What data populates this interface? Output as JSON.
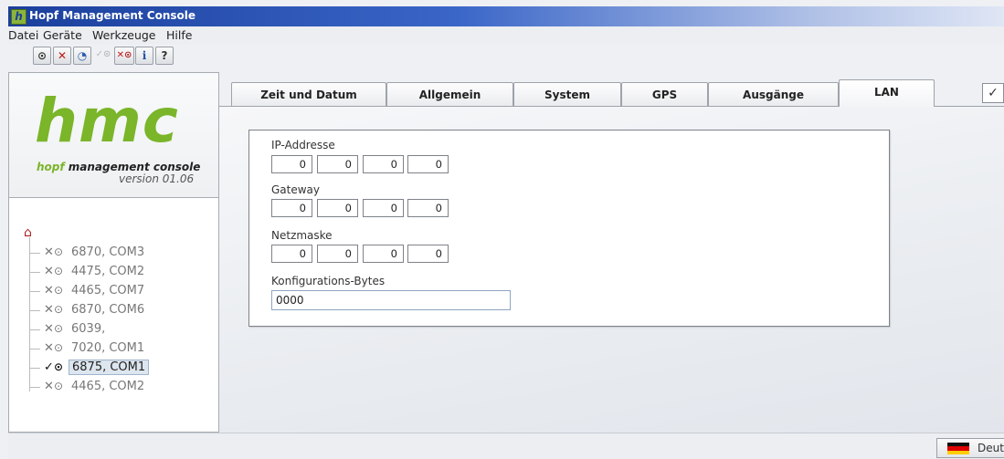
{
  "window": {
    "title": "Hopf Management Console"
  },
  "menu": [
    "Datei",
    "Geräte",
    "Werkzeuge",
    "Hilfe"
  ],
  "toolbar": [
    {
      "icon": "clock-icon",
      "glyph": "⊙"
    },
    {
      "icon": "disconnect-icon",
      "glyph": "✕"
    },
    {
      "icon": "refresh-icon",
      "glyph": "◔"
    },
    {
      "icon": "connect-icon-disabled",
      "glyph": "✓⊙"
    },
    {
      "icon": "disconnect-all-icon",
      "glyph": "✕⊙"
    },
    {
      "icon": "info-icon",
      "glyph": "i"
    },
    {
      "icon": "help-icon",
      "glyph": "?"
    }
  ],
  "branding": {
    "logo": "hmc",
    "subtitle_brand": "hopf",
    "subtitle_rest": " management console",
    "version": "version 01.06"
  },
  "tree": {
    "items": [
      {
        "label": "6870, COM3",
        "status": "✕",
        "selected": false
      },
      {
        "label": "4475, COM2",
        "status": "✕",
        "selected": false
      },
      {
        "label": "4465, COM7",
        "status": "✕",
        "selected": false
      },
      {
        "label": "6870, COM6",
        "status": "✕",
        "selected": false
      },
      {
        "label": "6039,",
        "status": "✕",
        "selected": false
      },
      {
        "label": "7020, COM1",
        "status": "✕",
        "selected": false
      },
      {
        "label": "6875, COM1",
        "status": "✓",
        "selected": true
      },
      {
        "label": "4465, COM2",
        "status": "✕",
        "selected": false
      }
    ]
  },
  "tabs": [
    {
      "label": "Zeit und Datum",
      "active": false
    },
    {
      "label": "Allgemein",
      "active": false
    },
    {
      "label": "System",
      "active": false
    },
    {
      "label": "GPS",
      "active": false
    },
    {
      "label": "Ausgänge",
      "active": false
    },
    {
      "label": "LAN",
      "active": true
    }
  ],
  "apply_button": {
    "glyph": "✓"
  },
  "lan": {
    "ip_label": "IP-Addresse",
    "ip": [
      "0",
      "0",
      "0",
      "0"
    ],
    "gateway_label": "Gateway",
    "gateway": [
      "0",
      "0",
      "0",
      "0"
    ],
    "netmask_label": "Netzmaske",
    "netmask": [
      "0",
      "0",
      "0",
      "0"
    ],
    "config_label": "Konfigurations-Bytes",
    "config_value": "0000"
  },
  "status": {
    "language": "Deut"
  },
  "colors": {
    "accent": "#7ab52a",
    "title_bar": "#1b3f9c"
  }
}
